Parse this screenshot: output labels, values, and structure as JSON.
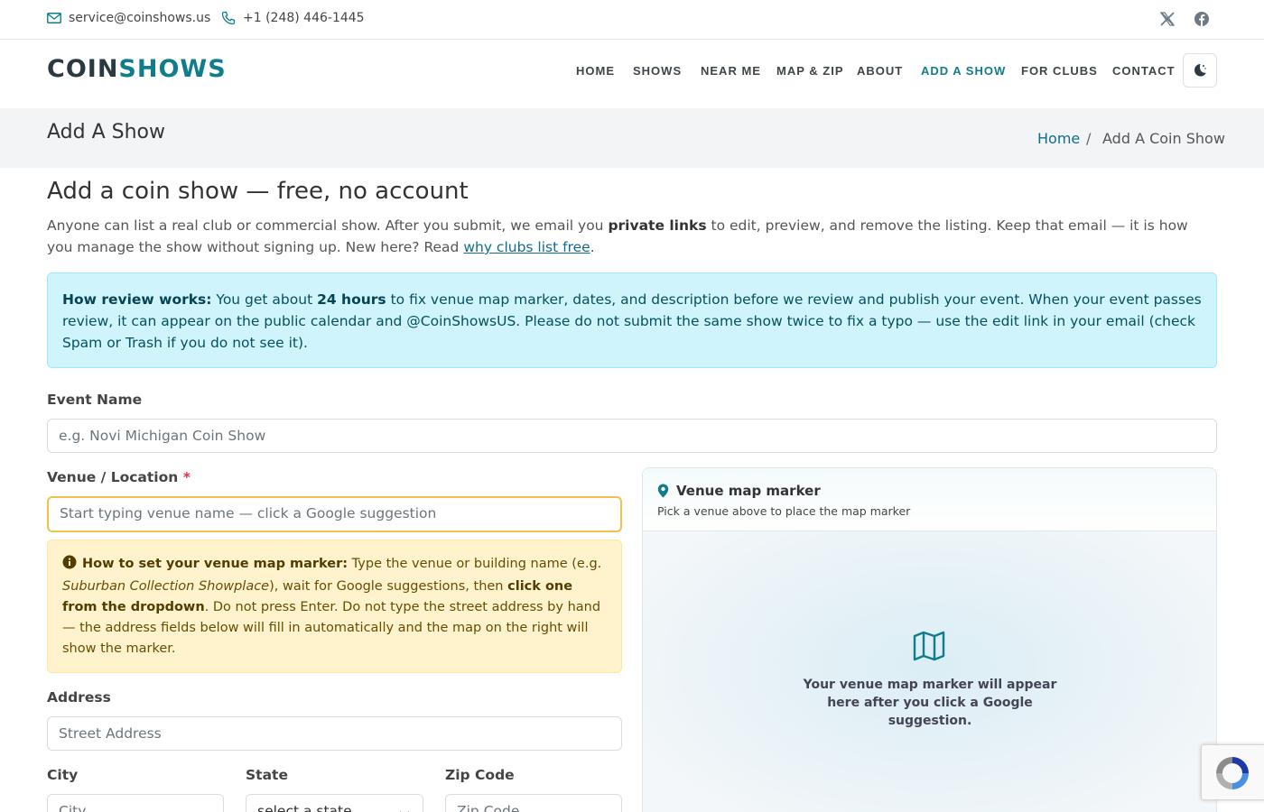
{
  "topbar": {
    "email": "service@coinshows.us",
    "phone": "+1 (248) 446-1445",
    "social_icons": [
      "x-twitter-icon",
      "facebook-icon"
    ]
  },
  "header": {
    "logo_part1": "COIN",
    "logo_part2": "SHOWS",
    "nav": [
      "HOME",
      "SHOWS",
      "NEAR ME",
      "MAP & ZIP",
      "ABOUT",
      "ADD A SHOW",
      "FOR CLUBS",
      "CONTACT"
    ],
    "active_nav": "ADD A SHOW",
    "theme_icon": "moon-icon"
  },
  "titlebar": {
    "title": "Add A Show",
    "breadcrumb_home": "Home",
    "breadcrumb_sep": "/",
    "breadcrumb_current": "Add A Coin Show"
  },
  "main": {
    "heading": "Add a coin show — free, no account",
    "lead_1": "Anyone can list a real club or commercial show. After you submit, we email you ",
    "lead_bold": "private links",
    "lead_2": " to edit, preview, and remove the listing. Keep that email — it is how you manage the show without signing up. New here? Read ",
    "lead_link": "why clubs list free",
    "lead_end": ".",
    "info_bold": "How review works:",
    "info_1": " You get about ",
    "info_bold2": "24 hours",
    "info_2": " to fix venue map marker, dates, and description before we review and publish your event. When your event passes review, it can appear on the public calendar and @CoinShowsUS. Please do not submit the same show twice to fix a typo — use the edit link in your email (check Spam or Trash if you do not see it)."
  },
  "form": {
    "event_name_label": "Event Name",
    "event_name_placeholder": "e.g. Novi Michigan Coin Show",
    "venue_label": "Venue / Location",
    "venue_required": "*",
    "venue_placeholder": "Start typing venue name — click a Google suggestion",
    "warn_bold": "How to set your venue map marker:",
    "warn_1": " Type the venue or building name (e.g. ",
    "warn_italic": "Suburban Collection Showplace",
    "warn_2": "), wait for Google suggestions, then ",
    "warn_bold2": "click one from the dropdown",
    "warn_3": ". Do not press Enter. Do not type the street address by hand — the address fields below will fill in automatically and the map on the right will show the marker.",
    "address_label": "Address",
    "address_placeholder": "Street Address",
    "city_label": "City",
    "city_placeholder": "City",
    "state_label": "State",
    "state_value": "select a state",
    "zip_label": "Zip Code",
    "zip_placeholder": "Zip Code"
  },
  "map_panel": {
    "title": "Venue map marker",
    "subtitle": "Pick a venue above to place the map marker",
    "empty_text": "Your venue map marker will appear here after you click a Google suggestion."
  },
  "colors": {
    "brand": "#0f7d8c",
    "info_bg": "#cff4fc",
    "warn_bg": "#fff3cd",
    "focus_border": "#f0c24b"
  }
}
